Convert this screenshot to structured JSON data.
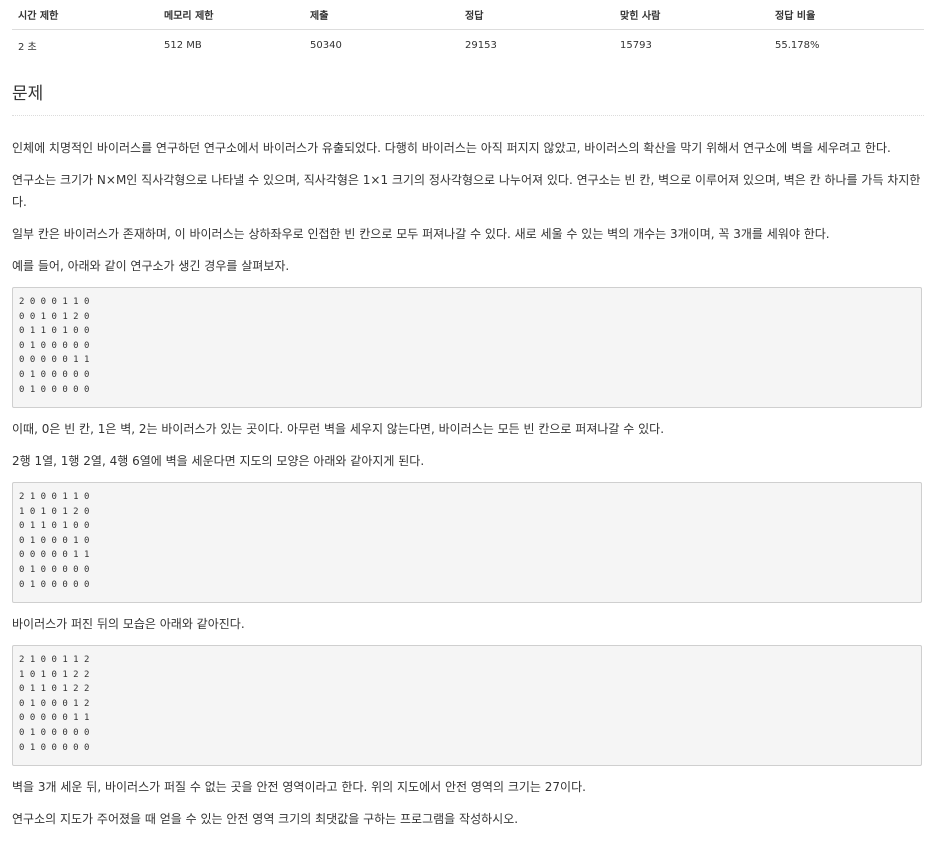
{
  "stats": {
    "headers": [
      "시간 제한",
      "메모리 제한",
      "제출",
      "정답",
      "맞힌 사람",
      "정답 비율"
    ],
    "values": [
      "2 초",
      "512 MB",
      "50340",
      "29153",
      "15793",
      "55.178%"
    ]
  },
  "problem": {
    "title": "문제",
    "p1": "인체에 치명적인 바이러스를 연구하던 연구소에서 바이러스가 유출되었다. 다행히 바이러스는 아직 퍼지지 않았고, 바이러스의 확산을 막기 위해서 연구소에 벽을 세우려고 한다.",
    "p2": "연구소는 크기가 N×M인 직사각형으로 나타낼 수 있으며, 직사각형은 1×1 크기의 정사각형으로 나누어져 있다. 연구소는 빈 칸, 벽으로 이루어져 있으며, 벽은 칸 하나를 가득 차지한다.",
    "p3": "일부 칸은 바이러스가 존재하며, 이 바이러스는 상하좌우로 인접한 빈 칸으로 모두 퍼져나갈 수 있다. 새로 세울 수 있는 벽의 개수는 3개이며, 꼭 3개를 세워야 한다.",
    "p4": "예를 들어, 아래와 같이 연구소가 생긴 경우를 살펴보자.",
    "board1": "2 0 0 0 1 1 0\n0 0 1 0 1 2 0\n0 1 1 0 1 0 0\n0 1 0 0 0 0 0\n0 0 0 0 0 1 1\n0 1 0 0 0 0 0\n0 1 0 0 0 0 0",
    "p5": "이때, 0은 빈 칸, 1은 벽, 2는 바이러스가 있는 곳이다. 아무런 벽을 세우지 않는다면, 바이러스는 모든 빈 칸으로 퍼져나갈 수 있다.",
    "p6": "2행 1열, 1행 2열, 4행 6열에 벽을 세운다면 지도의 모양은 아래와 같아지게 된다.",
    "board2": "2 1 0 0 1 1 0\n1 0 1 0 1 2 0\n0 1 1 0 1 0 0\n0 1 0 0 0 1 0\n0 0 0 0 0 1 1\n0 1 0 0 0 0 0\n0 1 0 0 0 0 0",
    "p7": "바이러스가 퍼진 뒤의 모습은 아래와 같아진다.",
    "board3": "2 1 0 0 1 1 2\n1 0 1 0 1 2 2\n0 1 1 0 1 2 2\n0 1 0 0 0 1 2\n0 0 0 0 0 1 1\n0 1 0 0 0 0 0\n0 1 0 0 0 0 0",
    "p8": "벽을 3개 세운 뒤, 바이러스가 퍼질 수 없는 곳을 안전 영역이라고 한다. 위의 지도에서 안전 영역의 크기는 27이다.",
    "p9": "연구소의 지도가 주어졌을 때 얻을 수 있는 안전 영역 크기의 최댓값을 구하는 프로그램을 작성하시오."
  }
}
